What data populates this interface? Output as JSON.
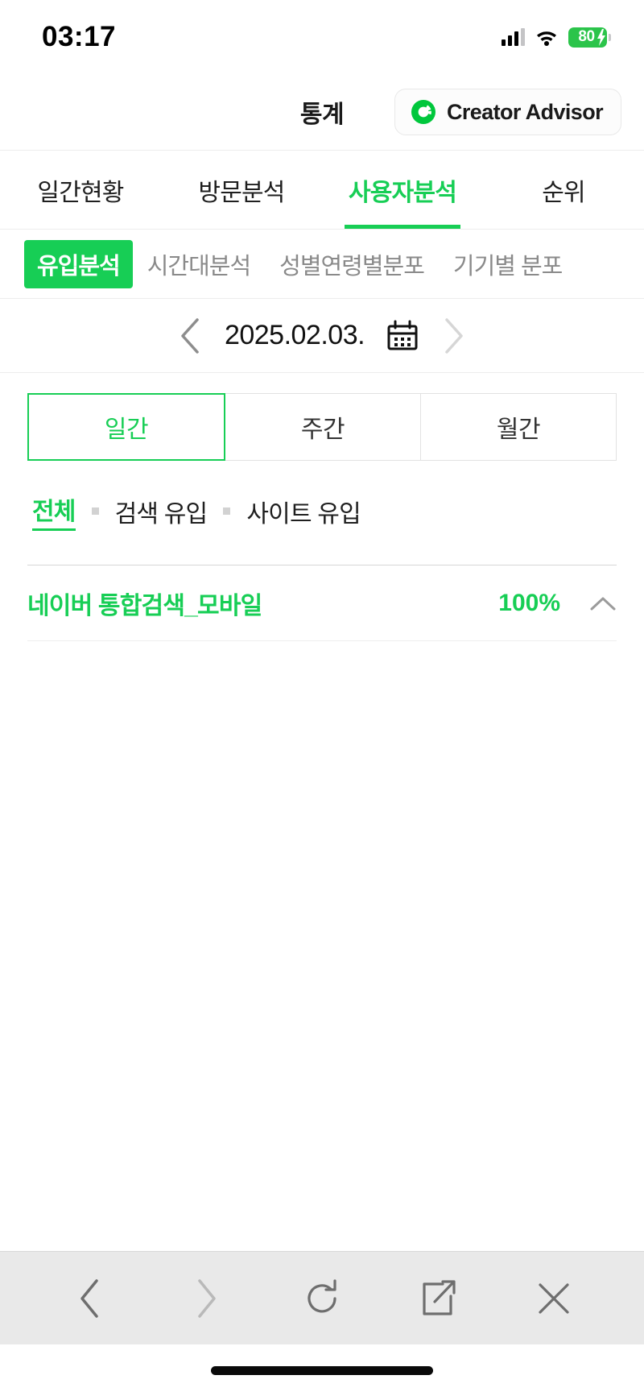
{
  "statusbar": {
    "time": "03:17",
    "battery_level": "80",
    "signal_icon": "cellular-signal-icon",
    "wifi_icon": "wifi-icon",
    "battery_icon": "battery-charging-icon"
  },
  "header": {
    "title": "통계",
    "brand_label": "Creator Advisor",
    "brand_logo_icon": "creator-advisor-logo-icon"
  },
  "main_tabs": [
    {
      "label": "일간현황",
      "active": false
    },
    {
      "label": "방문분석",
      "active": false
    },
    {
      "label": "사용자분석",
      "active": true
    },
    {
      "label": "순위",
      "active": false
    }
  ],
  "sub_tabs": [
    {
      "label": "유입분석",
      "active": true
    },
    {
      "label": "시간대분석",
      "active": false
    },
    {
      "label": "성별연령별분포",
      "active": false
    },
    {
      "label": "기기별 분포",
      "active": false
    }
  ],
  "date_nav": {
    "prev_icon": "chevron-left-icon",
    "date": "2025.02.03.",
    "calendar_icon": "calendar-icon",
    "next_icon": "chevron-right-icon"
  },
  "period_segments": [
    {
      "label": "일간",
      "active": true
    },
    {
      "label": "주간",
      "active": false
    },
    {
      "label": "월간",
      "active": false
    }
  ],
  "filters": [
    {
      "label": "전체",
      "active": true
    },
    {
      "label": "검색 유입",
      "active": false
    },
    {
      "label": "사이트 유입",
      "active": false
    }
  ],
  "inflow_list": [
    {
      "label": "네이버 통합검색_모바일",
      "value": "100%",
      "chevron_icon": "chevron-up-icon"
    }
  ],
  "bottom_toolbar": [
    {
      "icon": "back-chevron-icon",
      "enabled": true
    },
    {
      "icon": "forward-chevron-icon",
      "enabled": false
    },
    {
      "icon": "refresh-icon",
      "enabled": true
    },
    {
      "icon": "share-icon",
      "enabled": true
    },
    {
      "icon": "close-icon",
      "enabled": true
    }
  ],
  "colors": {
    "accent_green": "#17ce55",
    "battery_green": "#2bc44a",
    "text_dark": "#1a1a1a",
    "text_muted": "#8a8a8a",
    "toolbar_bg": "#e9e9e9"
  }
}
